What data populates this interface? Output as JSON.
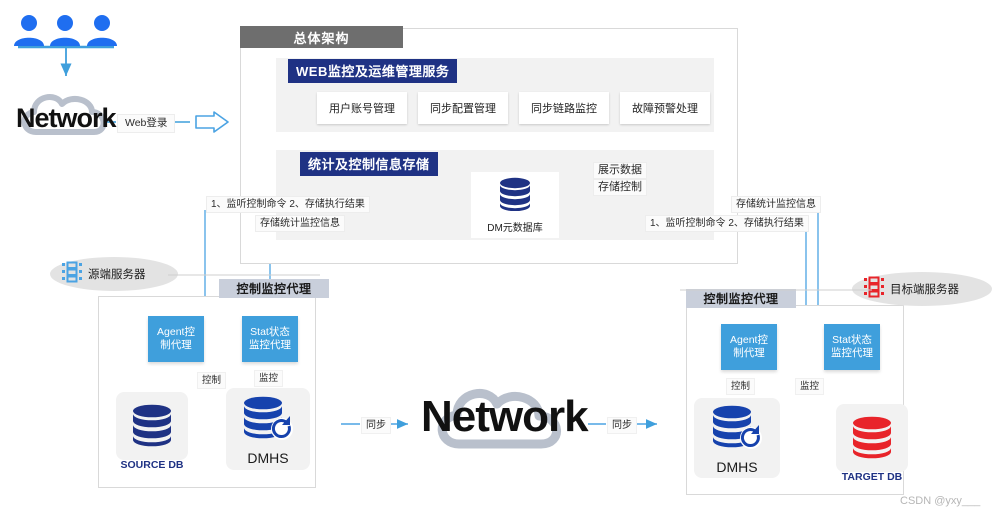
{
  "diagram": {
    "title": "总体架构",
    "watermark": "CSDN @yxy___"
  },
  "users": {
    "cloud_label": "Network",
    "login_label": "Web登录"
  },
  "web_panel": {
    "title": "WEB监控及运维管理服务",
    "cards": [
      {
        "label": "用户账号管理"
      },
      {
        "label": "同步配置管理"
      },
      {
        "label": "同步链路监控"
      },
      {
        "label": "故障预警处理"
      }
    ]
  },
  "store_panel": {
    "title": "统计及控制信息存储",
    "db_label": "DM元数据库",
    "display_label_1": "展示数据",
    "display_label_2": "存储控制"
  },
  "flows": {
    "left_top": "1、监听控制命令 2、存储执行结果",
    "left_bottom": "存储统计监控信息",
    "right_top": "存储统计监控信息",
    "right_bottom": "1、监听控制命令 2、存储执行结果",
    "sync_left": "同步",
    "sync_right": "同步",
    "center_cloud": "Network"
  },
  "source_side": {
    "server_label": "源端服务器",
    "sys_title": "控制监控代理",
    "agent_label": "Agent控\n制代理",
    "agent_line1": "Agent控",
    "agent_line2": "制代理",
    "stat_line1": "Stat状态",
    "stat_line2": "监控代理",
    "control_label": "控制",
    "monitor_label": "监控",
    "db_caption": "SOURCE DB",
    "dmhs_caption": "DMHS"
  },
  "target_side": {
    "server_label": "目标端服务器",
    "sys_title": "控制监控代理",
    "agent_line1": "Agent控",
    "agent_line2": "制代理",
    "stat_line1": "Stat状态",
    "stat_line2": "监控代理",
    "control_label": "控制",
    "monitor_label": "监控",
    "dmhs_caption": "DMHS",
    "db_caption": "TARGET DB"
  },
  "colors": {
    "navy": "#1f3284",
    "light_blue": "#3f9fdc",
    "arrow_blue": "#4ba3e3",
    "gray_header": "#6e6e6e",
    "red": "#e8242a",
    "panel_gray": "#f2f2f2"
  }
}
